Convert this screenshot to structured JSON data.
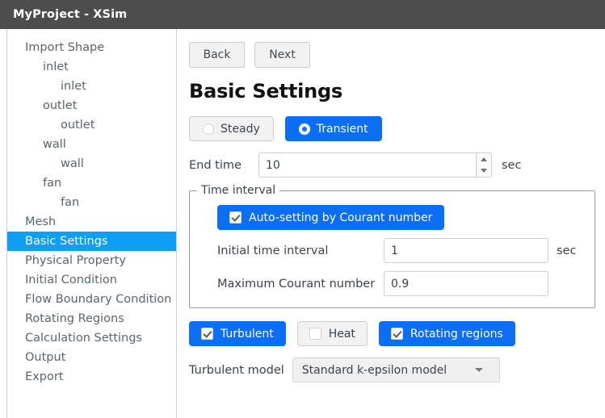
{
  "window": {
    "title": "MyProject - XSim"
  },
  "sidebar": {
    "items": [
      {
        "label": "Import Shape",
        "depth": 0,
        "selected": false
      },
      {
        "label": "inlet",
        "depth": 1,
        "selected": false
      },
      {
        "label": "inlet",
        "depth": 2,
        "selected": false
      },
      {
        "label": "outlet",
        "depth": 1,
        "selected": false
      },
      {
        "label": "outlet",
        "depth": 2,
        "selected": false
      },
      {
        "label": "wall",
        "depth": 1,
        "selected": false
      },
      {
        "label": "wall",
        "depth": 2,
        "selected": false
      },
      {
        "label": "fan",
        "depth": 1,
        "selected": false
      },
      {
        "label": "fan",
        "depth": 2,
        "selected": false
      },
      {
        "label": "Mesh",
        "depth": 0,
        "selected": false
      },
      {
        "label": "Basic Settings",
        "depth": 0,
        "selected": true
      },
      {
        "label": "Physical Property",
        "depth": 0,
        "selected": false
      },
      {
        "label": "Initial Condition",
        "depth": 0,
        "selected": false
      },
      {
        "label": "Flow Boundary Condition",
        "depth": 0,
        "selected": false,
        "wrap": true
      },
      {
        "label": "Rotating Regions",
        "depth": 0,
        "selected": false
      },
      {
        "label": "Calculation Settings",
        "depth": 0,
        "selected": false
      },
      {
        "label": "Output",
        "depth": 0,
        "selected": false
      },
      {
        "label": "Export",
        "depth": 0,
        "selected": false
      }
    ]
  },
  "toolbar": {
    "back_label": "Back",
    "next_label": "Next"
  },
  "main": {
    "page_title": "Basic Settings",
    "solver_mode": {
      "steady_label": "Steady",
      "steady_selected": false,
      "transient_label": "Transient",
      "transient_selected": true
    },
    "end_time": {
      "label": "End time",
      "value": "10",
      "unit": "sec"
    },
    "time_interval": {
      "legend": "Time interval",
      "auto_setting": {
        "label": "Auto-setting by Courant number",
        "checked": true
      },
      "initial_time_interval": {
        "label": "Initial time interval",
        "value": "1",
        "unit": "sec"
      },
      "maximum_courant_number": {
        "label": "Maximum Courant number",
        "value": "0.9"
      }
    },
    "physics": {
      "turbulent": {
        "label": "Turbulent",
        "checked": true
      },
      "heat": {
        "label": "Heat",
        "checked": false
      },
      "rotating_regions": {
        "label": "Rotating regions",
        "checked": true
      }
    },
    "turbulent_model": {
      "label": "Turbulent model",
      "value": "Standard k-epsilon model"
    }
  },
  "colors": {
    "titlebar": "#4d4d4d",
    "selection_blue": "#0c9ff5",
    "accent_blue": "#0b6ef4"
  }
}
